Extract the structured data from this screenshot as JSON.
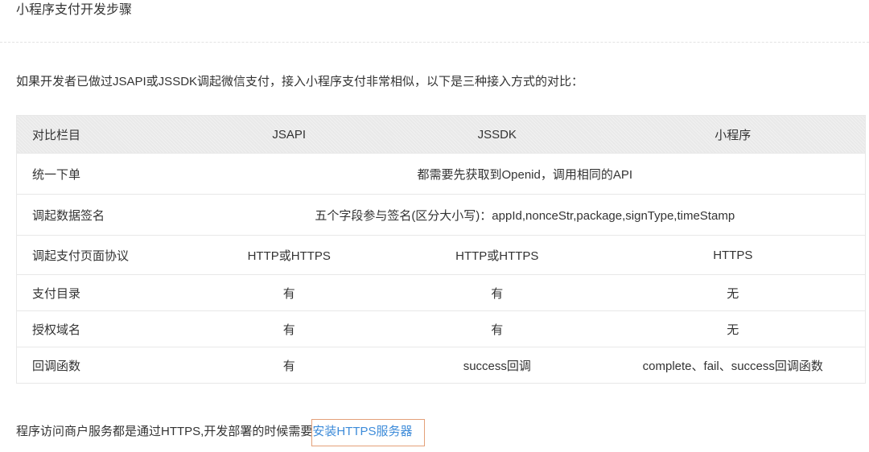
{
  "page_title": "小程序支付开发步骤",
  "intro": "如果开发者已做过JSAPI或JSSDK调起微信支付，接入小程序支付非常相似，以下是三种接入方式的对比：",
  "table": {
    "headers": [
      "对比栏目",
      "JSAPI",
      "JSSDK",
      "小程序"
    ],
    "rows": [
      {
        "label": "统一下单",
        "merged": "都需要先获取到Openid，调用相同的API"
      },
      {
        "label": "调起数据签名",
        "merged": "五个字段参与签名(区分大小写)：appId,nonceStr,package,signType,timeStamp"
      },
      {
        "label": "调起支付页面协议",
        "cells": [
          "HTTP或HTTPS",
          "HTTP或HTTPS",
          "HTTPS"
        ]
      },
      {
        "label": "支付目录",
        "cells": [
          "有",
          "有",
          "无"
        ]
      },
      {
        "label": "授权域名",
        "cells": [
          "有",
          "有",
          "无"
        ]
      },
      {
        "label": "回调函数",
        "cells": [
          "有",
          "success回调",
          "complete、fail、success回调函数"
        ]
      }
    ]
  },
  "footer": {
    "text": "程序访问商户服务都是通过HTTPS,开发部署的时候需要",
    "link_label": "安装HTTPS服务器",
    "link_color": "#3d8bd9"
  }
}
